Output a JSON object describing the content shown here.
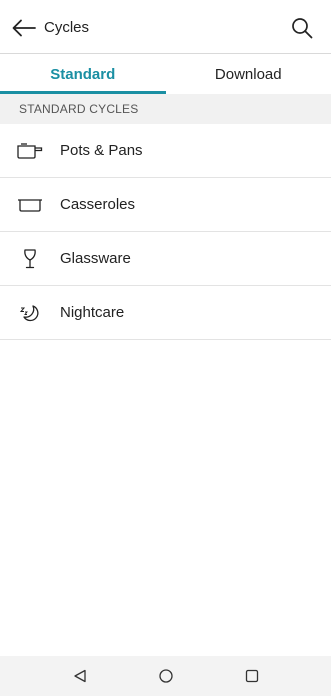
{
  "header": {
    "title": "Cycles",
    "back_icon": "arrow-left-icon",
    "search_icon": "search-icon"
  },
  "tabs": [
    {
      "label": "Standard",
      "active": true
    },
    {
      "label": "Download",
      "active": false
    }
  ],
  "section": {
    "title": "STANDARD CYCLES"
  },
  "cycles": [
    {
      "label": "Pots & Pans",
      "icon": "pot-icon"
    },
    {
      "label": "Casseroles",
      "icon": "casserole-icon"
    },
    {
      "label": "Glassware",
      "icon": "wine-glass-icon"
    },
    {
      "label": "Nightcare",
      "icon": "moon-sleep-icon"
    }
  ],
  "navbar": {
    "back_icon": "nav-back-icon",
    "home_icon": "nav-home-icon",
    "recent_icon": "nav-recent-icon"
  },
  "colors": {
    "accent": "#1a8fa3",
    "section_bg": "#f1f1f1",
    "navbar_bg": "#f3f3f3"
  }
}
